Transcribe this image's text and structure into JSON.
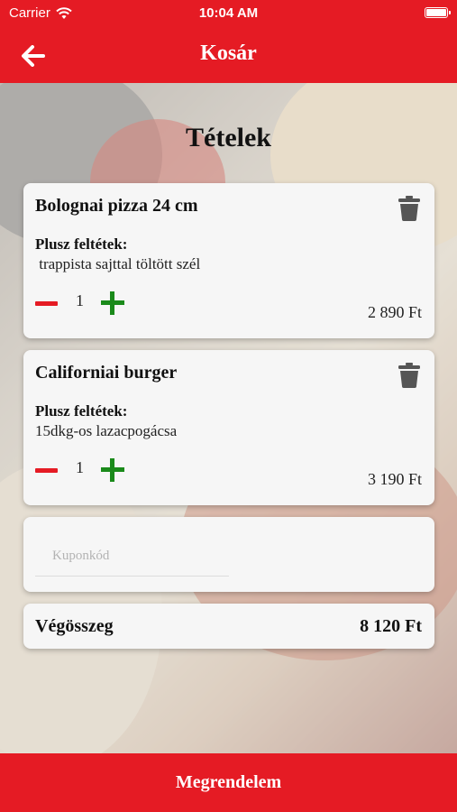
{
  "status": {
    "carrier": "Carrier",
    "time": "10:04 AM"
  },
  "nav": {
    "title": "Kosár"
  },
  "section": {
    "title": "Tételek"
  },
  "items": [
    {
      "name": "Bolognai pizza 24 cm",
      "extras_label": "Plusz feltétek:",
      "extras_value": " trappista sajttal töltött szél",
      "qty": "1",
      "price": "2 890 Ft"
    },
    {
      "name": "Californiai burger",
      "extras_label": "Plusz feltétek:",
      "extras_value": "15dkg-os lazacpogácsa",
      "qty": "1",
      "price": "3 190 Ft"
    }
  ],
  "coupon": {
    "placeholder": "Kuponkód",
    "value": ""
  },
  "total": {
    "label": "Végösszeg",
    "value": "8 120 Ft"
  },
  "footer": {
    "order_label": "Megrendelem"
  },
  "colors": {
    "brand": "#e51b24",
    "plus": "#1a8a1a",
    "minus": "#e51b24",
    "trash": "#555555"
  },
  "icons": {
    "back": "arrow-left-icon",
    "trash": "trash-icon",
    "minus": "minus-icon",
    "plus": "plus-icon",
    "wifi": "wifi-icon",
    "battery": "battery-icon"
  }
}
